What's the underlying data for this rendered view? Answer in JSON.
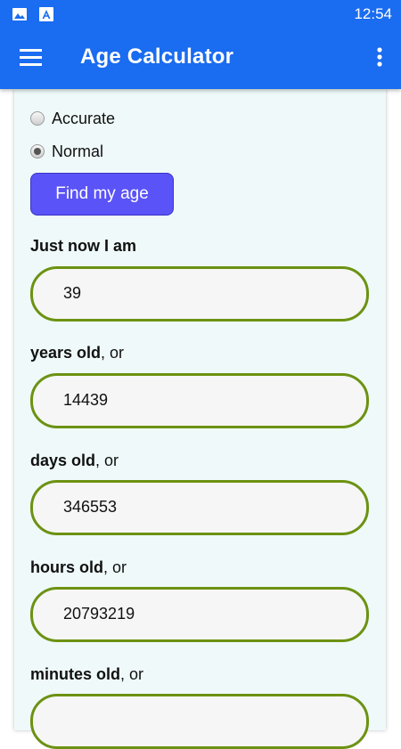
{
  "status_bar": {
    "time": "12:54",
    "icons": [
      "image-icon",
      "accessibility-a-icon"
    ]
  },
  "app_bar": {
    "title": "Age Calculator",
    "menu_icon": "hamburger-menu-icon",
    "overflow_icon": "more-vert-icon",
    "color": "#1a6cf0"
  },
  "mode_options": [
    {
      "label": "Accurate",
      "selected": false
    },
    {
      "label": "Normal",
      "selected": true
    }
  ],
  "find_button": {
    "label": "Find my age",
    "color": "#5a53f7"
  },
  "results": [
    {
      "label_bold": "Just now I am",
      "label_rest": "",
      "value": "39"
    },
    {
      "label_bold": "years old",
      "label_rest": ", or",
      "value": "14439"
    },
    {
      "label_bold": "days old",
      "label_rest": ", or",
      "value": "346553"
    },
    {
      "label_bold": "hours old",
      "label_rest": ", or",
      "value": "20793219"
    },
    {
      "label_bold": "minutes old",
      "label_rest": ", or",
      "value": ""
    }
  ],
  "colors": {
    "field_border": "#6c9212",
    "card_bg": "#eff9f9"
  }
}
